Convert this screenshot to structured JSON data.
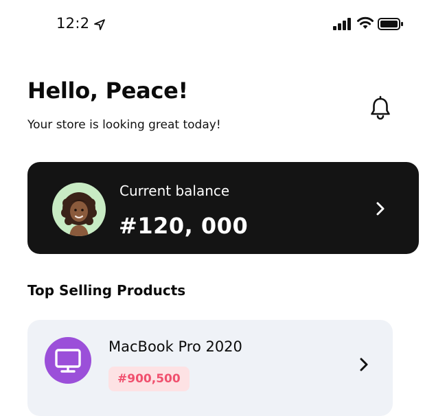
{
  "status_bar": {
    "time": "12:2",
    "icons": [
      "location-arrow-icon",
      "cellular-signal-icon",
      "wifi-icon",
      "battery-icon"
    ]
  },
  "header": {
    "greeting": "Hello, Peace!",
    "subtitle": "Your store is looking great today!",
    "notification_icon": "bell-icon"
  },
  "balance_card": {
    "label": "Current balance",
    "amount": "#120, 000",
    "background": "#141414",
    "avatar_bg": "#c8ebc4"
  },
  "top_products": {
    "title": "Top Selling Products",
    "items": [
      {
        "name": "MacBook Pro 2020",
        "price": "#900,500",
        "icon": "monitor-icon",
        "icon_bg": "#9b4fd9",
        "price_color": "#f0506e",
        "price_bg": "#fde2e4"
      }
    ]
  }
}
